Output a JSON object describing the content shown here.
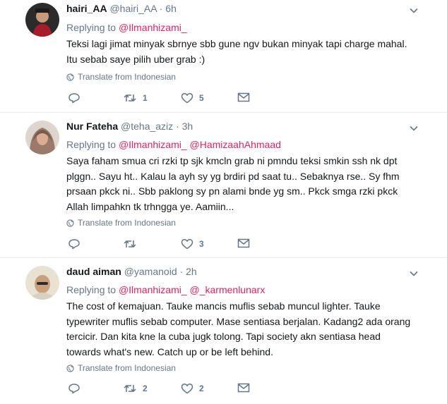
{
  "tweets": [
    {
      "name": "hairi_AA",
      "handle": "@hairi_AA",
      "sep": "·",
      "time": "6h",
      "replying_label": "Replying to",
      "mentions": [
        "@Ilmanhizami_"
      ],
      "lines": [
        "Teksi lagi jimat minyak sbrnye sbb gune ngv bukan minyak tapi charge mahal.",
        "Itu sebab saye pilih uber grab  :)"
      ],
      "translate": "Translate from Indonesian",
      "replies": "",
      "retweets": "1",
      "likes": "5"
    },
    {
      "name": "Nur Fateha",
      "handle": "@teha_aziz",
      "sep": "·",
      "time": "3h",
      "replying_label": "Replying to",
      "mentions": [
        "@Ilmanhizami_",
        "@HamizaahAhmaad"
      ],
      "lines": [
        "Saya faham smua cri rzki tp sjk kmcln grab ni pmndu teksi smkin ssh nk dpt",
        "plggn..  Sayu ht..  Kalau la ayh sy yg brdiri pd saat tu..  Sebaknya rse..  Sy fhm",
        "prsaan pkck ni..  Sbb paklong sy pn alami bnde yg sm.. Pkck smga rzki pkck",
        "Allah limpahkn tk trhngga ye. Aamiin..."
      ],
      "translate": "Translate from Indonesian",
      "replies": "",
      "retweets": "",
      "likes": "3"
    },
    {
      "name": "daud aiman",
      "handle": "@yamanoid",
      "sep": "·",
      "time": "2h",
      "replying_label": "Replying to",
      "mentions": [
        "@Ilmanhizami_",
        "@_karmenlunarx"
      ],
      "lines": [
        "The cost of kemajuan. Tauke mancis muflis sebab muncul lighter. Tauke",
        "typewriter muflis sebab computer. Mase sentiasa berjalan. Kadang2 ada orang",
        "tercicir. Dan kita kne la cuba jugk tolong. Tapi society akn sentiasa head",
        "towards what's new. Catch up or be left behind."
      ],
      "translate": "Translate from Indonesian",
      "replies": "",
      "retweets": "2",
      "likes": "2"
    }
  ],
  "colors": {
    "mention": "#e0245e",
    "meta": "#657786",
    "text": "#14171a",
    "divider": "#e6ecf0"
  },
  "icons": [
    "chevron-down-icon",
    "globe-icon",
    "reply-icon",
    "retweet-icon",
    "like-icon",
    "message-icon"
  ]
}
